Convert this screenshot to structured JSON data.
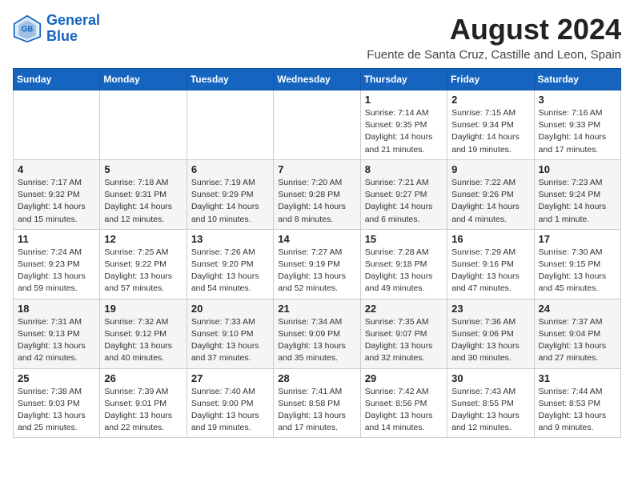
{
  "logo": {
    "line1": "General",
    "line2": "Blue"
  },
  "title": "August 2024",
  "subtitle": "Fuente de Santa Cruz, Castille and Leon, Spain",
  "headers": [
    "Sunday",
    "Monday",
    "Tuesday",
    "Wednesday",
    "Thursday",
    "Friday",
    "Saturday"
  ],
  "weeks": [
    [
      {
        "day": "",
        "info": ""
      },
      {
        "day": "",
        "info": ""
      },
      {
        "day": "",
        "info": ""
      },
      {
        "day": "",
        "info": ""
      },
      {
        "day": "1",
        "info": "Sunrise: 7:14 AM\nSunset: 9:35 PM\nDaylight: 14 hours\nand 21 minutes."
      },
      {
        "day": "2",
        "info": "Sunrise: 7:15 AM\nSunset: 9:34 PM\nDaylight: 14 hours\nand 19 minutes."
      },
      {
        "day": "3",
        "info": "Sunrise: 7:16 AM\nSunset: 9:33 PM\nDaylight: 14 hours\nand 17 minutes."
      }
    ],
    [
      {
        "day": "4",
        "info": "Sunrise: 7:17 AM\nSunset: 9:32 PM\nDaylight: 14 hours\nand 15 minutes."
      },
      {
        "day": "5",
        "info": "Sunrise: 7:18 AM\nSunset: 9:31 PM\nDaylight: 14 hours\nand 12 minutes."
      },
      {
        "day": "6",
        "info": "Sunrise: 7:19 AM\nSunset: 9:29 PM\nDaylight: 14 hours\nand 10 minutes."
      },
      {
        "day": "7",
        "info": "Sunrise: 7:20 AM\nSunset: 9:28 PM\nDaylight: 14 hours\nand 8 minutes."
      },
      {
        "day": "8",
        "info": "Sunrise: 7:21 AM\nSunset: 9:27 PM\nDaylight: 14 hours\nand 6 minutes."
      },
      {
        "day": "9",
        "info": "Sunrise: 7:22 AM\nSunset: 9:26 PM\nDaylight: 14 hours\nand 4 minutes."
      },
      {
        "day": "10",
        "info": "Sunrise: 7:23 AM\nSunset: 9:24 PM\nDaylight: 14 hours\nand 1 minute."
      }
    ],
    [
      {
        "day": "11",
        "info": "Sunrise: 7:24 AM\nSunset: 9:23 PM\nDaylight: 13 hours\nand 59 minutes."
      },
      {
        "day": "12",
        "info": "Sunrise: 7:25 AM\nSunset: 9:22 PM\nDaylight: 13 hours\nand 57 minutes."
      },
      {
        "day": "13",
        "info": "Sunrise: 7:26 AM\nSunset: 9:20 PM\nDaylight: 13 hours\nand 54 minutes."
      },
      {
        "day": "14",
        "info": "Sunrise: 7:27 AM\nSunset: 9:19 PM\nDaylight: 13 hours\nand 52 minutes."
      },
      {
        "day": "15",
        "info": "Sunrise: 7:28 AM\nSunset: 9:18 PM\nDaylight: 13 hours\nand 49 minutes."
      },
      {
        "day": "16",
        "info": "Sunrise: 7:29 AM\nSunset: 9:16 PM\nDaylight: 13 hours\nand 47 minutes."
      },
      {
        "day": "17",
        "info": "Sunrise: 7:30 AM\nSunset: 9:15 PM\nDaylight: 13 hours\nand 45 minutes."
      }
    ],
    [
      {
        "day": "18",
        "info": "Sunrise: 7:31 AM\nSunset: 9:13 PM\nDaylight: 13 hours\nand 42 minutes."
      },
      {
        "day": "19",
        "info": "Sunrise: 7:32 AM\nSunset: 9:12 PM\nDaylight: 13 hours\nand 40 minutes."
      },
      {
        "day": "20",
        "info": "Sunrise: 7:33 AM\nSunset: 9:10 PM\nDaylight: 13 hours\nand 37 minutes."
      },
      {
        "day": "21",
        "info": "Sunrise: 7:34 AM\nSunset: 9:09 PM\nDaylight: 13 hours\nand 35 minutes."
      },
      {
        "day": "22",
        "info": "Sunrise: 7:35 AM\nSunset: 9:07 PM\nDaylight: 13 hours\nand 32 minutes."
      },
      {
        "day": "23",
        "info": "Sunrise: 7:36 AM\nSunset: 9:06 PM\nDaylight: 13 hours\nand 30 minutes."
      },
      {
        "day": "24",
        "info": "Sunrise: 7:37 AM\nSunset: 9:04 PM\nDaylight: 13 hours\nand 27 minutes."
      }
    ],
    [
      {
        "day": "25",
        "info": "Sunrise: 7:38 AM\nSunset: 9:03 PM\nDaylight: 13 hours\nand 25 minutes."
      },
      {
        "day": "26",
        "info": "Sunrise: 7:39 AM\nSunset: 9:01 PM\nDaylight: 13 hours\nand 22 minutes."
      },
      {
        "day": "27",
        "info": "Sunrise: 7:40 AM\nSunset: 9:00 PM\nDaylight: 13 hours\nand 19 minutes."
      },
      {
        "day": "28",
        "info": "Sunrise: 7:41 AM\nSunset: 8:58 PM\nDaylight: 13 hours\nand 17 minutes."
      },
      {
        "day": "29",
        "info": "Sunrise: 7:42 AM\nSunset: 8:56 PM\nDaylight: 13 hours\nand 14 minutes."
      },
      {
        "day": "30",
        "info": "Sunrise: 7:43 AM\nSunset: 8:55 PM\nDaylight: 13 hours\nand 12 minutes."
      },
      {
        "day": "31",
        "info": "Sunrise: 7:44 AM\nSunset: 8:53 PM\nDaylight: 13 hours\nand 9 minutes."
      }
    ]
  ]
}
